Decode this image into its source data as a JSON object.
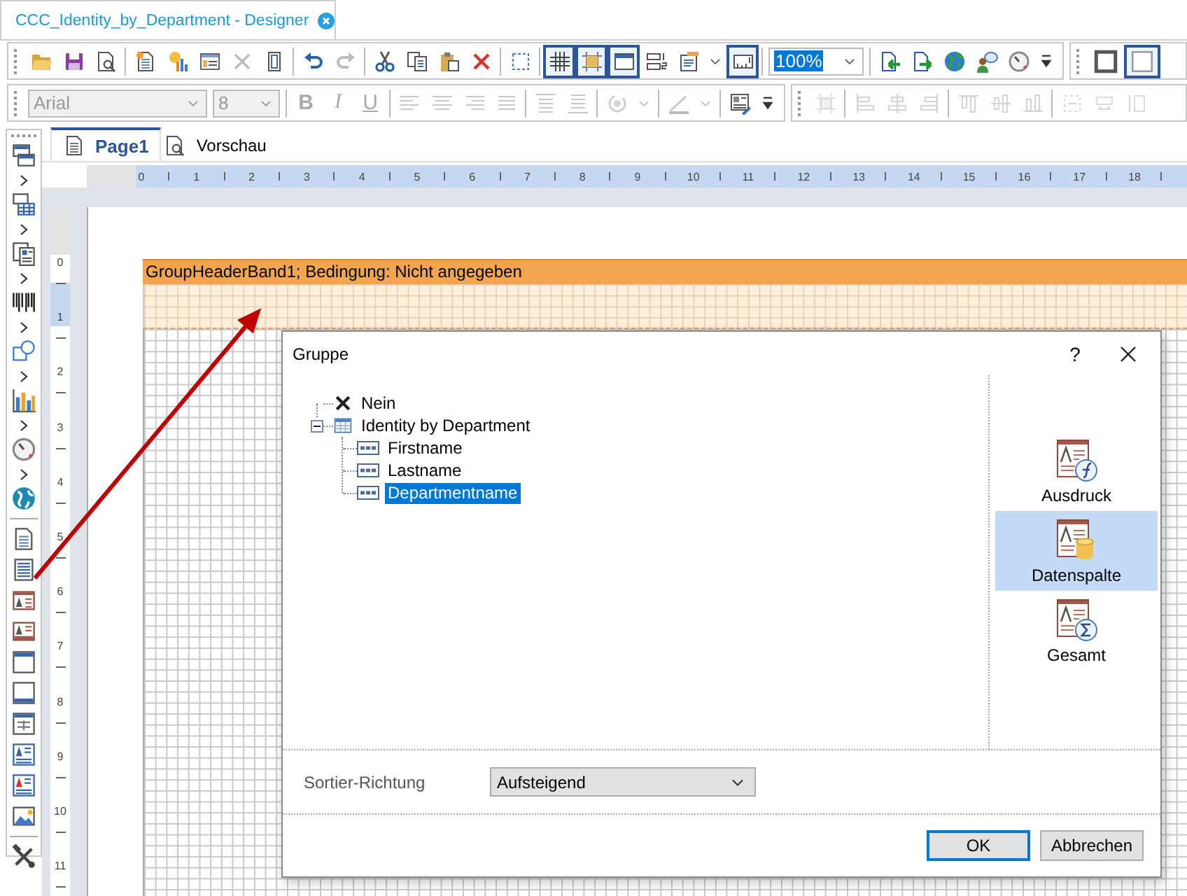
{
  "document_tab": {
    "title": "CCC_Identity_by_Department - Designer",
    "selected": true
  },
  "toolbar_main": [
    {
      "items": [
        {
          "kind": "open",
          "on": false,
          "disabled": false
        },
        {
          "kind": "save",
          "on": false,
          "disabled": false
        },
        {
          "kind": "preview",
          "on": false,
          "disabled": false
        }
      ]
    },
    {
      "items": [
        {
          "kind": "newpage",
          "on": false,
          "disabled": false
        },
        {
          "kind": "wizard",
          "on": false,
          "disabled": false
        },
        {
          "kind": "form",
          "on": false,
          "disabled": false
        },
        {
          "kind": "delete",
          "on": false,
          "disabled": true
        },
        {
          "kind": "copypage",
          "on": false,
          "disabled": false
        }
      ]
    },
    {
      "items": [
        {
          "kind": "undo",
          "on": false,
          "disabled": false
        },
        {
          "kind": "redo",
          "on": false,
          "disabled": true
        }
      ]
    },
    {
      "items": [
        {
          "kind": "cut",
          "on": false,
          "disabled": false
        },
        {
          "kind": "copy",
          "on": false,
          "disabled": false
        },
        {
          "kind": "paste",
          "on": false,
          "disabled": false
        },
        {
          "kind": "deletered",
          "on": false,
          "disabled": false
        }
      ]
    },
    {
      "items": [
        {
          "kind": "selectall",
          "on": false,
          "disabled": false
        }
      ]
    },
    {
      "items": [
        {
          "kind": "grid",
          "on": true,
          "disabled": false
        },
        {
          "kind": "snap",
          "on": true,
          "disabled": false
        },
        {
          "kind": "header",
          "on": true,
          "disabled": false
        },
        {
          "kind": "bands",
          "on": false,
          "disabled": false
        },
        {
          "kind": "textedit",
          "on": false,
          "disabled": false
        },
        {
          "kind": "caret",
          "on": false,
          "disabled": false
        },
        {
          "kind": "ruler",
          "on": true,
          "disabled": false
        }
      ]
    },
    {
      "items": [
        {
          "kind": "combo",
          "value": "100%",
          "value_selected": true,
          "disabled": false
        }
      ]
    },
    {
      "items": [
        {
          "kind": "import",
          "on": false,
          "disabled": false
        },
        {
          "kind": "export",
          "on": false,
          "disabled": false
        },
        {
          "kind": "globe",
          "on": false,
          "disabled": false
        },
        {
          "kind": "chat",
          "on": false,
          "disabled": false
        },
        {
          "kind": "gauge",
          "on": false,
          "disabled": false
        },
        {
          "kind": "overflow",
          "on": false,
          "disabled": false
        }
      ]
    }
  ],
  "toolbar_borders": [
    {
      "items": [
        {
          "kind": "framethick",
          "on": false,
          "disabled": false
        },
        {
          "kind": "framethin",
          "on": true,
          "disabled": false
        }
      ]
    }
  ],
  "toolbar_format": [
    {
      "items": [
        {
          "kind": "combo",
          "value": "Arial",
          "value_selected": false,
          "disabled": true
        },
        {
          "kind": "combo",
          "value": "8",
          "value_selected": false,
          "disabled": true
        }
      ]
    },
    {
      "items": [
        {
          "kind": "letter",
          "label": "B",
          "on": false,
          "disabled": true
        },
        {
          "kind": "letter",
          "label": "I",
          "on": false,
          "disabled": true
        },
        {
          "kind": "letter",
          "label": "U",
          "on": false,
          "disabled": true
        }
      ]
    },
    {
      "items": [
        {
          "kind": "alignleft",
          "on": false,
          "disabled": true
        },
        {
          "kind": "aligncenter",
          "on": false,
          "disabled": true
        },
        {
          "kind": "alignright",
          "on": false,
          "disabled": true
        },
        {
          "kind": "justify",
          "on": false,
          "disabled": true
        }
      ]
    },
    {
      "items": [
        {
          "kind": "valigntop",
          "on": false,
          "disabled": true
        },
        {
          "kind": "valignbottom",
          "on": false,
          "disabled": true
        }
      ]
    },
    {
      "items": [
        {
          "kind": "rotate",
          "on": false,
          "disabled": true
        },
        {
          "kind": "caret",
          "on": false,
          "disabled": true
        }
      ]
    },
    {
      "items": [
        {
          "kind": "linewidth",
          "on": false,
          "disabled": true
        },
        {
          "kind": "caret",
          "on": false,
          "disabled": true
        }
      ]
    },
    {
      "items": [
        {
          "kind": "textpen",
          "on": false,
          "disabled": false
        },
        {
          "kind": "overflow",
          "on": false,
          "disabled": false
        }
      ]
    }
  ],
  "toolbar_layout": [
    {
      "items": [
        {
          "kind": "sizegrid",
          "on": false,
          "disabled": true
        }
      ]
    },
    {
      "items": [
        {
          "kind": "objleft",
          "on": false,
          "disabled": true
        },
        {
          "kind": "objcenter",
          "on": false,
          "disabled": true
        },
        {
          "kind": "objright",
          "on": false,
          "disabled": true
        }
      ]
    },
    {
      "items": [
        {
          "kind": "objtop",
          "on": false,
          "disabled": true
        },
        {
          "kind": "objmiddle",
          "on": false,
          "disabled": true
        },
        {
          "kind": "objbottom",
          "on": false,
          "disabled": true
        }
      ]
    },
    {
      "items": [
        {
          "kind": "spacing",
          "on": false,
          "disabled": true
        },
        {
          "kind": "spacing2",
          "on": false,
          "disabled": true
        },
        {
          "kind": "spacing3",
          "on": false,
          "disabled": true
        }
      ]
    }
  ],
  "toolbox": [
    {
      "items": [
        {
          "kind": "windows",
          "submenu": true
        },
        {
          "kind": "tablewin",
          "submenu": true
        },
        {
          "kind": "formpage",
          "submenu": true
        },
        {
          "kind": "barcode",
          "submenu": true
        },
        {
          "kind": "shapes",
          "submenu": true
        },
        {
          "kind": "barchart",
          "submenu": true
        },
        {
          "kind": "gauge",
          "submenu": true
        },
        {
          "kind": "globe2",
          "submenu": false
        }
      ]
    },
    {
      "items": [
        {
          "kind": "pagelines",
          "submenu": false
        },
        {
          "kind": "striped",
          "submenu": false
        },
        {
          "kind": "textframe",
          "submenu": false
        },
        {
          "kind": "textframe2",
          "submenu": false
        },
        {
          "kind": "wintop",
          "submenu": false
        },
        {
          "kind": "winbottom",
          "submenu": false
        },
        {
          "kind": "calwin",
          "submenu": false
        },
        {
          "kind": "textlines",
          "submenu": false
        },
        {
          "kind": "richtext",
          "submenu": false
        },
        {
          "kind": "picture",
          "submenu": false
        }
      ]
    },
    {
      "items": [
        {
          "kind": "tools",
          "submenu": false
        }
      ]
    }
  ],
  "page_tabs": [
    {
      "label": "Page1",
      "selected": true,
      "kind": "page"
    },
    {
      "label": "Vorschau",
      "selected": false,
      "kind": "preview"
    }
  ],
  "ruler_h": [
    "0",
    "1",
    "2",
    "3",
    "4",
    "5",
    "6",
    "7",
    "8",
    "9",
    "10",
    "11",
    "12",
    "13",
    "14",
    "15",
    "16",
    "17",
    "18"
  ],
  "ruler_v": [
    "0",
    "1",
    "2",
    "3",
    "4",
    "5",
    "6",
    "7",
    "8",
    "9",
    "10",
    "11"
  ],
  "band": {
    "title": "GroupHeaderBand1; Bedingung: Nicht angegeben"
  },
  "dialog": {
    "title": "Gruppe",
    "help": "?",
    "tree": [
      {
        "label": "Nein",
        "kind": "none",
        "selected": false
      },
      {
        "label": "Identity by Department",
        "kind": "datasource",
        "selected": false,
        "expanded": true,
        "children": [
          {
            "label": "Firstname",
            "kind": "column",
            "selected": false
          },
          {
            "label": "Lastname",
            "kind": "column",
            "selected": false
          },
          {
            "label": "Departmentname",
            "kind": "column",
            "selected": true
          }
        ]
      }
    ],
    "source_types": [
      {
        "label": "Ausdruck",
        "kind": "expression",
        "selected": false
      },
      {
        "label": "Datenspalte",
        "kind": "column",
        "selected": true
      },
      {
        "label": "Gesamt",
        "kind": "total",
        "selected": false
      }
    ],
    "sort_label": "Sortier-Richtung",
    "sort_value": "Aufsteigend",
    "buttons": [
      {
        "label": "OK",
        "default": true
      },
      {
        "label": "Abbrechen",
        "default": false
      }
    ]
  }
}
